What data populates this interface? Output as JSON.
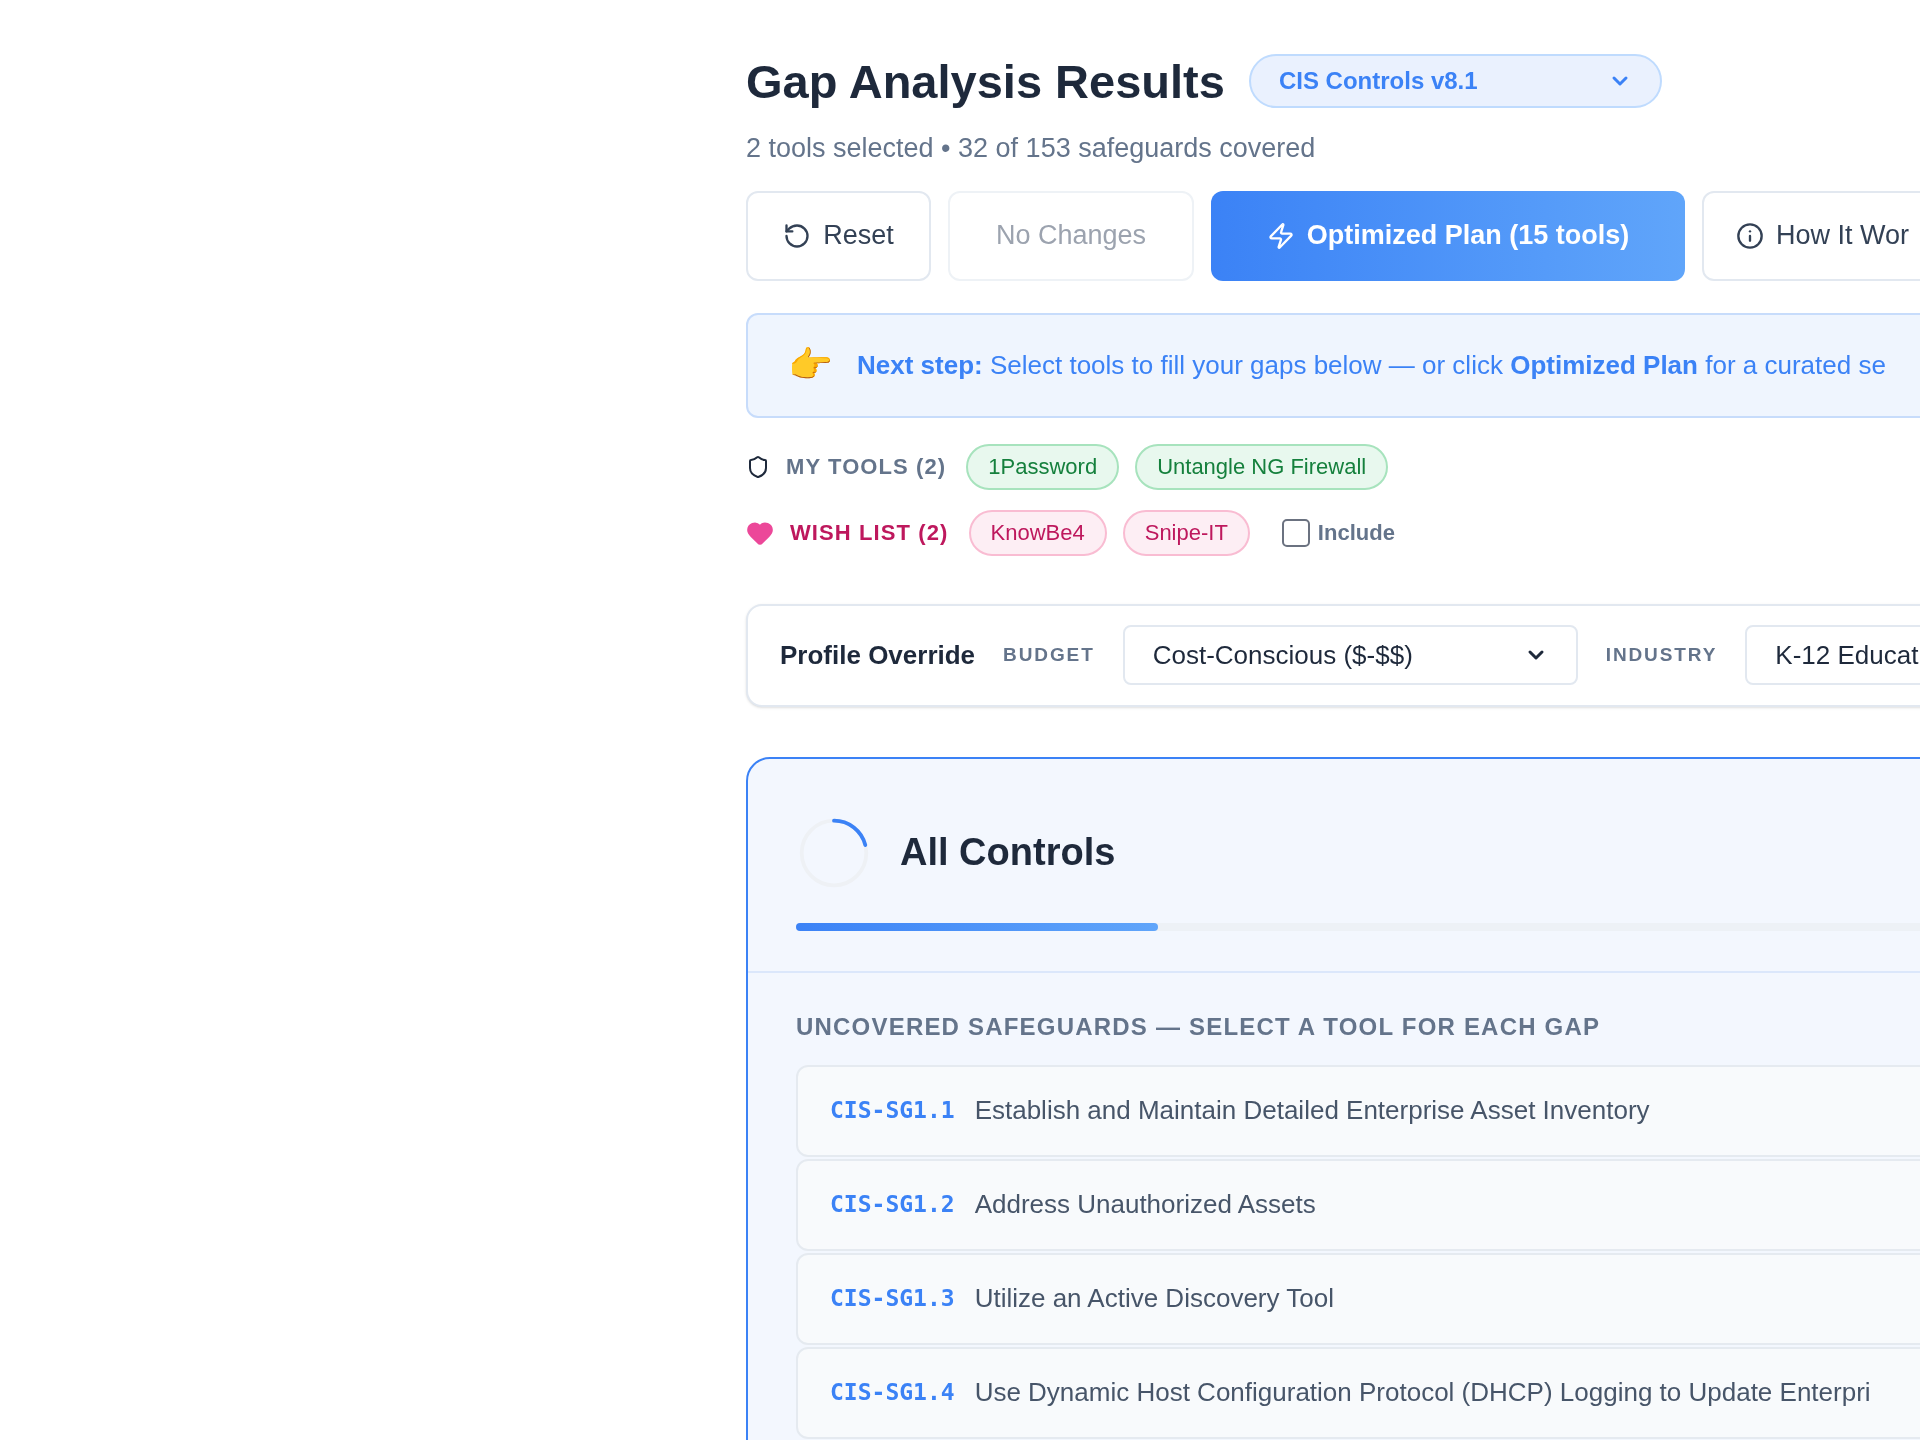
{
  "header": {
    "title": "Gap Analysis Results",
    "framework_select": {
      "value": "CIS Controls v8.1"
    },
    "summary": "2 tools selected • 32 of 153 safeguards covered"
  },
  "actions": [
    {
      "kind": "reset",
      "label": "Reset",
      "disabled": false
    },
    {
      "kind": "plain",
      "label": "No Changes",
      "disabled": true
    },
    {
      "kind": "primary",
      "label": "Optimized Plan (15 tools)",
      "disabled": false
    },
    {
      "kind": "info",
      "label": "How It Wor",
      "disabled": false
    }
  ],
  "banner": {
    "icon": "👉",
    "text": "**Next step:** Select tools to fill your gaps below — or click **Optimized Plan** for a curated se"
  },
  "my_tools": {
    "label": "MY TOOLS (2)",
    "tools": [
      "1Password",
      "Untangle NG Firewall"
    ]
  },
  "wish_list": {
    "label": "WISH LIST (2)",
    "tools": [
      "KnowBe4",
      "Snipe-IT"
    ],
    "include": {
      "label": "Include",
      "checked": false
    }
  },
  "profile_override": {
    "title": "Profile Override",
    "budget": {
      "label": "BUDGET",
      "value": "Cost-Conscious ($-$$)"
    },
    "industry": {
      "label": "INDUSTRY",
      "value": "K-12 Educat"
    }
  },
  "controls": {
    "title": "All Controls",
    "progress": {
      "level": 0.21
    },
    "section_heading": "UNCOVERED SAFEGUARDS — SELECT A TOOL FOR EACH GAP",
    "safeguards": [
      {
        "id": "CIS-SG1.1",
        "name": "Establish and Maintain Detailed Enterprise Asset Inventory"
      },
      {
        "id": "CIS-SG1.2",
        "name": "Address Unauthorized Assets"
      },
      {
        "id": "CIS-SG1.3",
        "name": "Utilize an Active Discovery Tool"
      },
      {
        "id": "CIS-SG1.4",
        "name": "Use Dynamic Host Configuration Protocol (DHCP) Logging to Update Enterpri"
      }
    ]
  }
}
